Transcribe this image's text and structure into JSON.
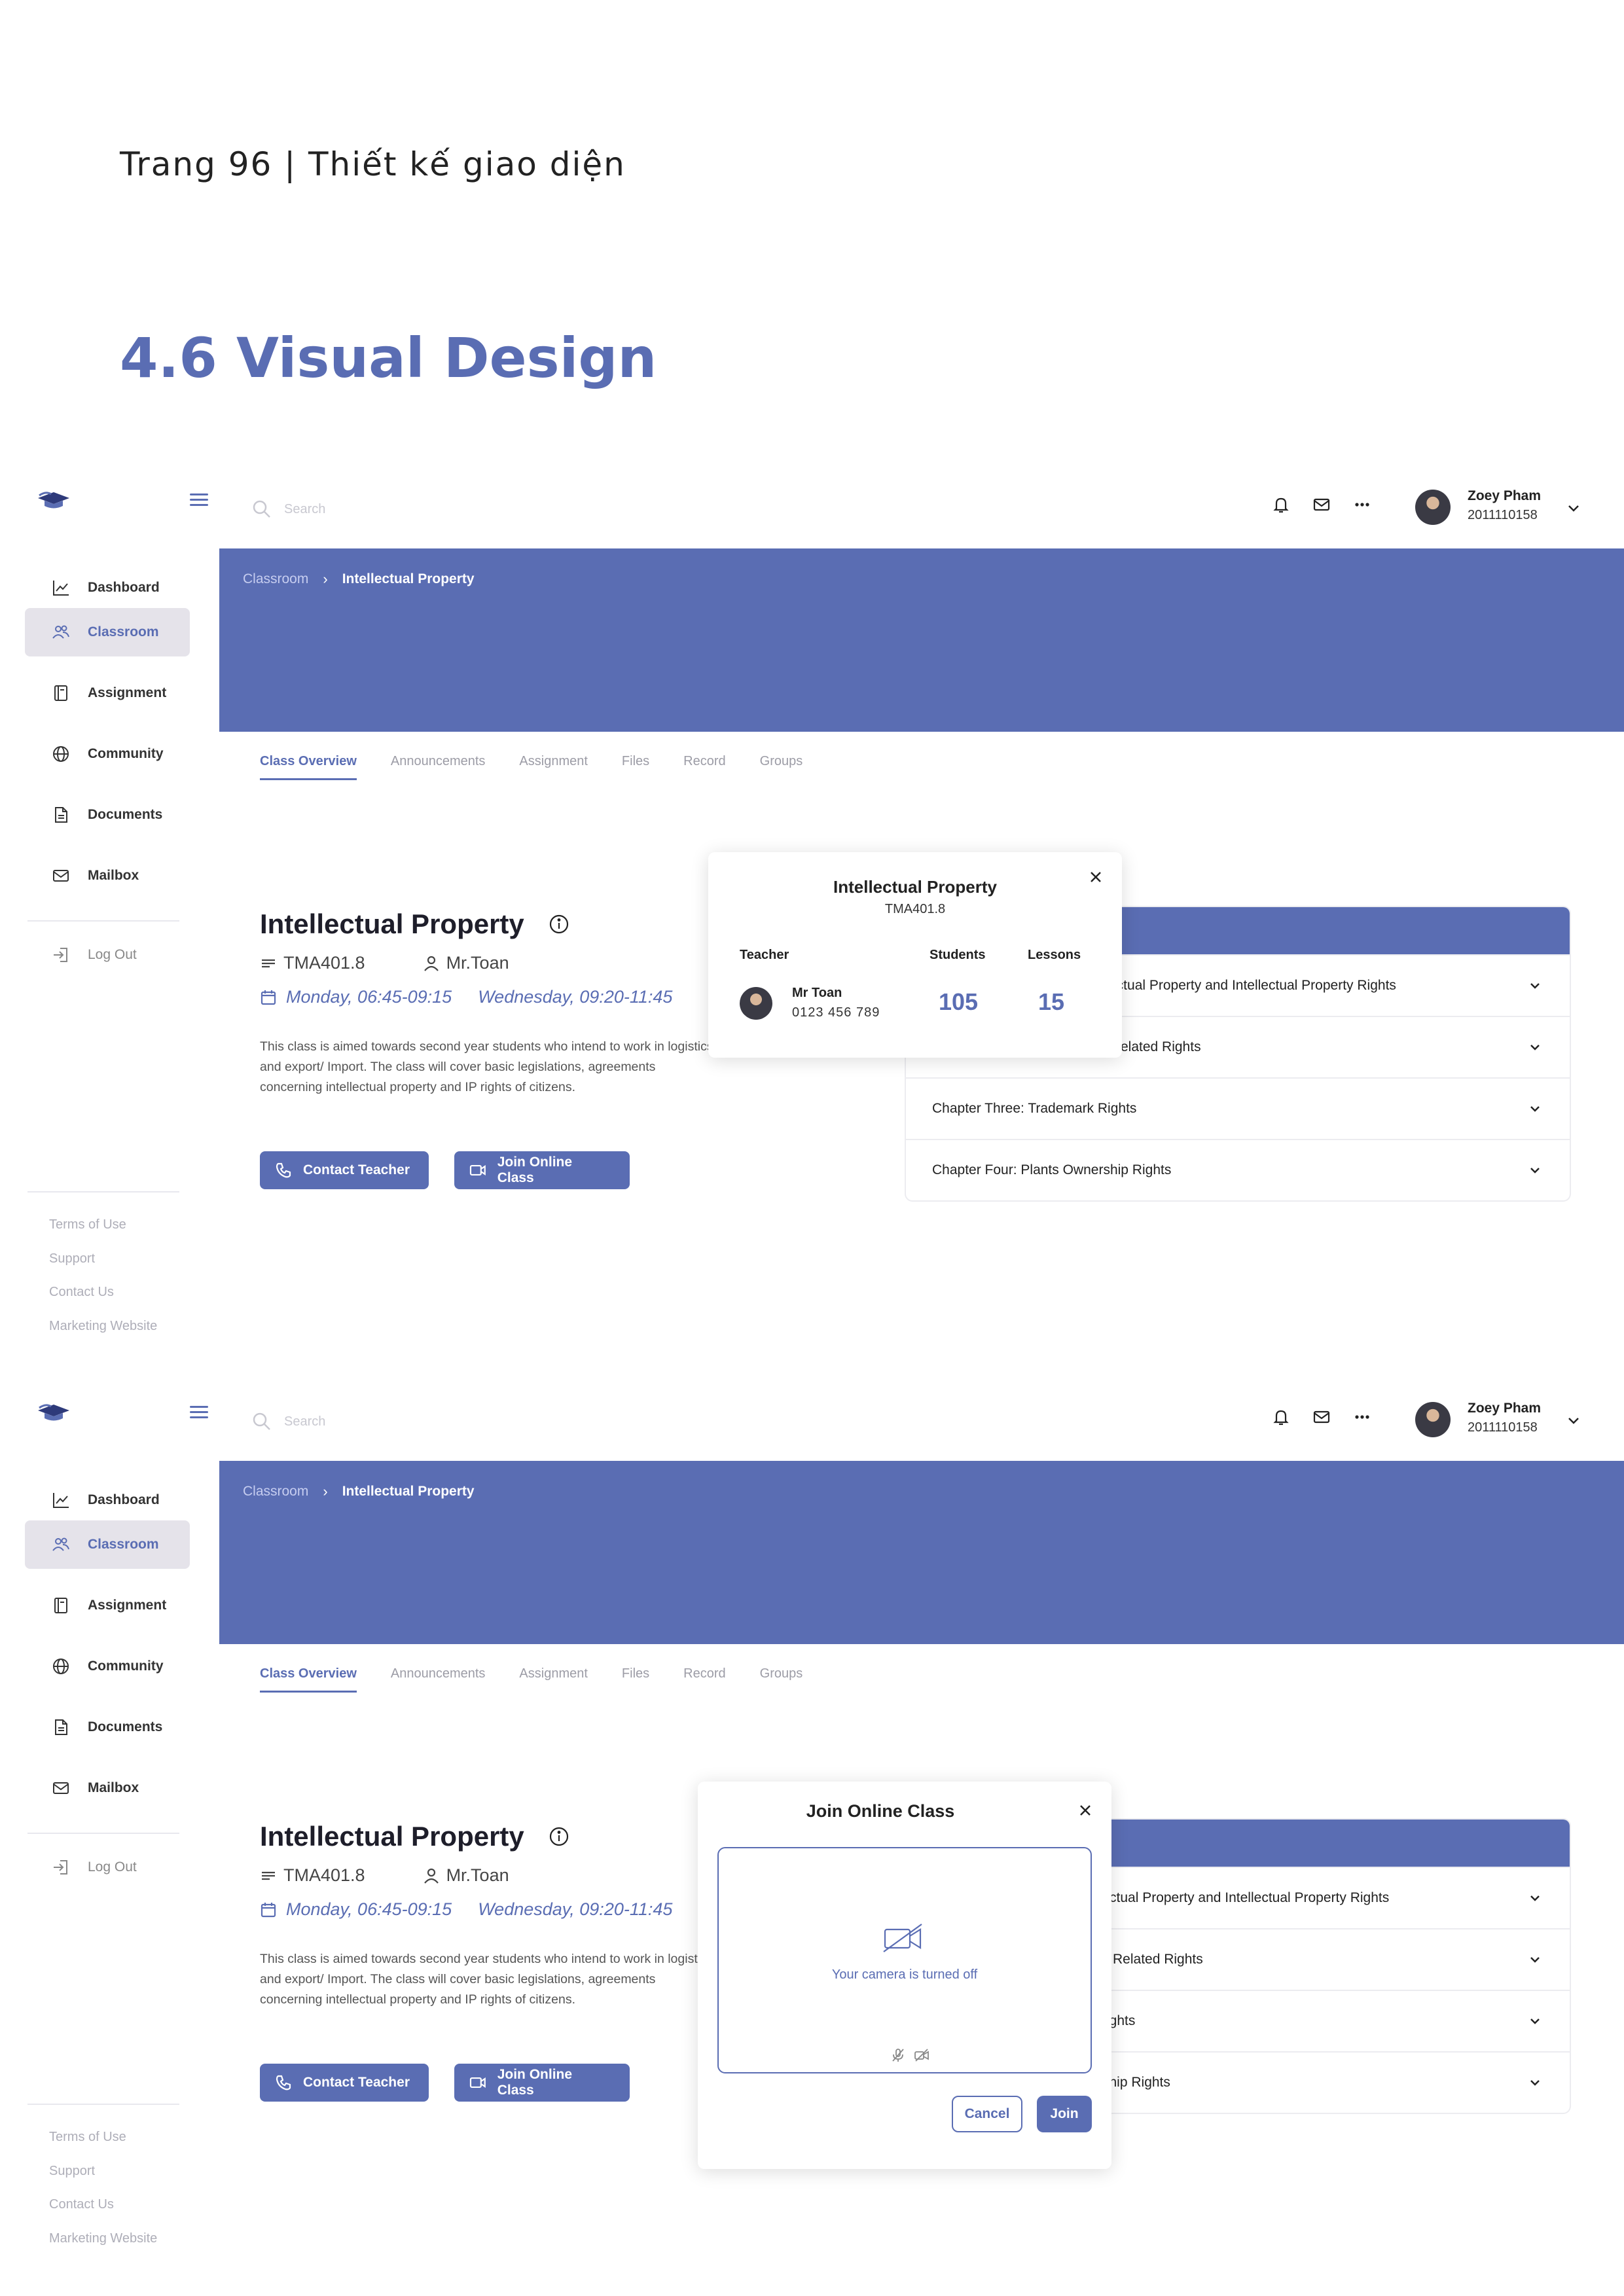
{
  "page": {
    "header": "Trang 96 | Thiết kế giao diện",
    "section_title": "4.6 Visual Design"
  },
  "colors": {
    "accent": "#5a6db3",
    "sidebar_active": "#e5e3ea",
    "muted_text": "#aeaeb8"
  },
  "sidebar": {
    "items": [
      {
        "label": "Dashboard",
        "icon": "chart-line-icon"
      },
      {
        "label": "Classroom",
        "icon": "users-icon",
        "active": true
      },
      {
        "label": "Assignment",
        "icon": "notebook-icon"
      },
      {
        "label": "Community",
        "icon": "globe-icon"
      },
      {
        "label": "Documents",
        "icon": "document-icon"
      },
      {
        "label": "Mailbox",
        "icon": "mail-icon"
      }
    ],
    "logout": "Log Out",
    "footer": [
      "Terms of Use",
      "Support",
      "Contact Us",
      "Marketing Website"
    ]
  },
  "topbar": {
    "search_placeholder": "Search",
    "user_name": "Zoey Pham",
    "user_id": "2011110158"
  },
  "breadcrumb": {
    "parent": "Classroom",
    "current": "Intellectual Property"
  },
  "tabs": [
    "Class Overview",
    "Announcements",
    "Assignment",
    "Files",
    "Record",
    "Groups"
  ],
  "class": {
    "title": "Intellectual Property",
    "code": "TMA401.8",
    "teacher": "Mr.Toan",
    "schedule_1": "Monday, 06:45-09:15",
    "schedule_2": "Wednesday, 09:20-11:45",
    "description": "This class is aimed towards second year students who intend to work in logistics and export/ Import. The class will cover basic legislations, agreements concerning intellectual property and IP rights of citizens.",
    "contact_button": "Contact Teacher",
    "join_button": "Join Online Class"
  },
  "chapters_m1": [
    "ectual Property and Intellectual Property Rights",
    "elated Rights",
    "Chapter Three: Trademark Rights",
    "Chapter Four: Plants Ownership Rights"
  ],
  "chapters_m2": [
    "llectual Property and Intellectual Property Rights",
    "Related Rights",
    "ights",
    "ship Rights"
  ],
  "info_popup": {
    "title": "Intellectual Property",
    "code": "TMA401.8",
    "teacher_header": "Teacher",
    "students_header": "Students",
    "lessons_header": "Lessons",
    "teacher_name": "Mr Toan",
    "teacher_phone": "0123 456 789",
    "students": "105",
    "lessons": "15"
  },
  "join_popup": {
    "title": "Join Online Class",
    "camera_text": "Your camera is turned off",
    "cancel": "Cancel",
    "join": "Join"
  }
}
